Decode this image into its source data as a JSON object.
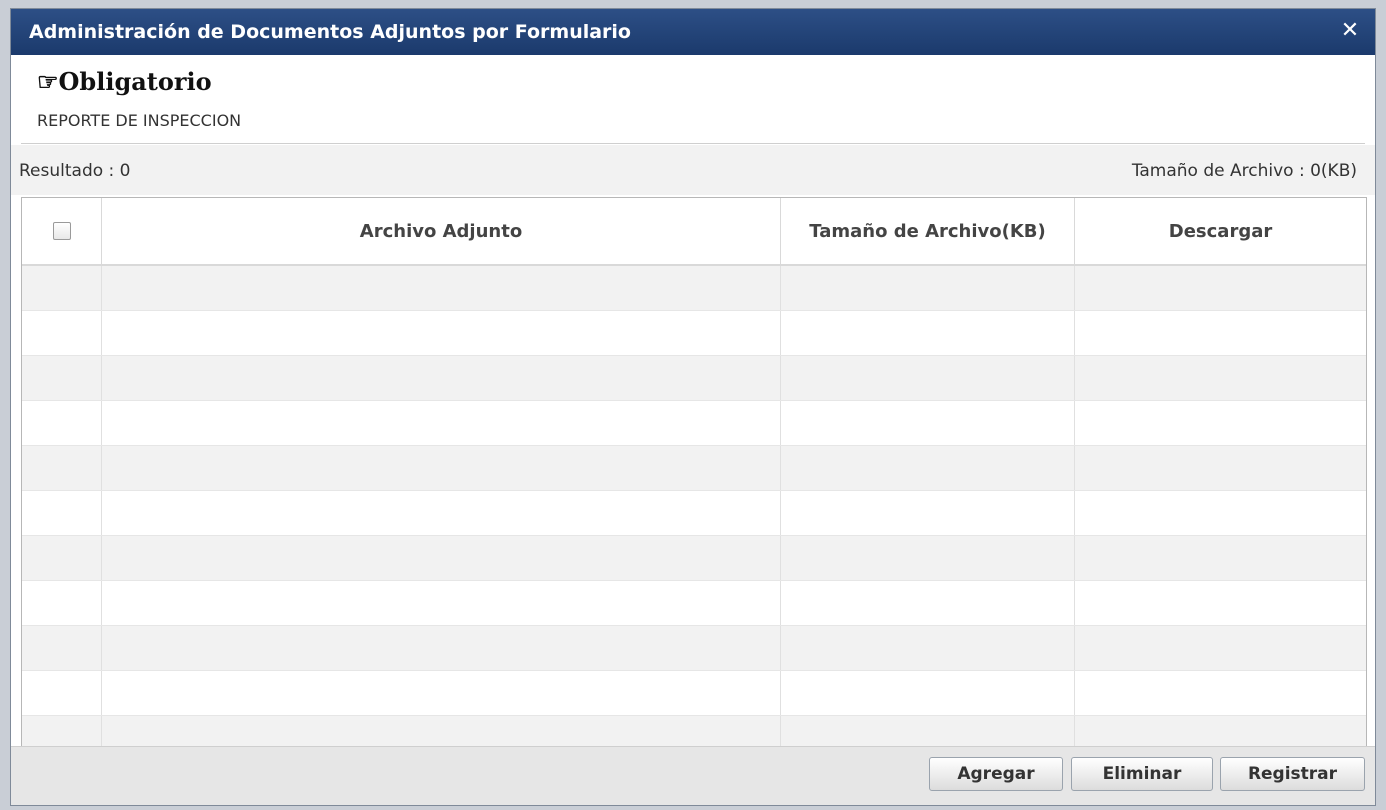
{
  "dialog": {
    "title": "Administración de Documentos Adjuntos por Formulario",
    "close_icon": "close-icon",
    "close_glyph": "✕"
  },
  "header": {
    "heading_icon": "pointing-hand-icon",
    "heading_glyph": "☞",
    "heading": "Obligatorio",
    "subtitle": "REPORTE DE INSPECCION"
  },
  "summary": {
    "result_label": "Resultado : 0",
    "file_size_label": "Tamaño de Archivo : 0(KB)"
  },
  "table": {
    "columns": [
      "Archivo Adjunto",
      "Tamaño de Archivo(KB)",
      "Descargar"
    ],
    "rows": [],
    "colors": {
      "alt_row": "#f2f2f2",
      "border": "#d9d9d9"
    }
  },
  "buttons": {
    "add": "Agregar",
    "delete": "Eliminar",
    "register": "Registrar"
  },
  "colors": {
    "titlebar": "#1b3a6c",
    "background": "#f2f2f2"
  }
}
